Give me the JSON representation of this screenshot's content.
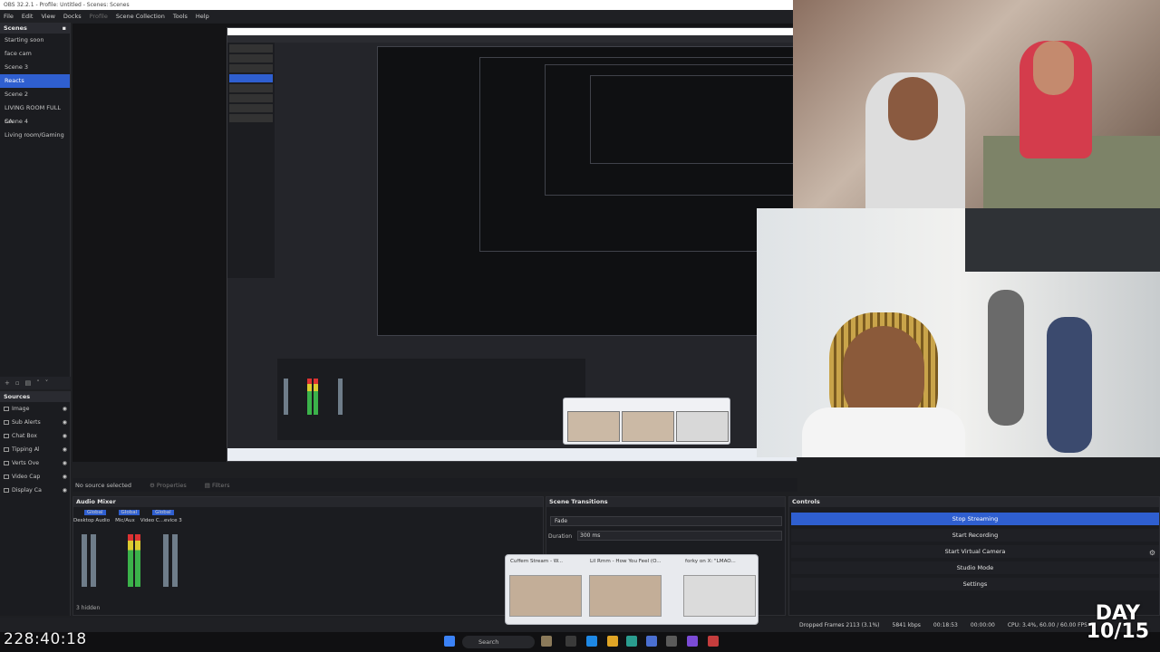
{
  "app": {
    "title": "OBS 32.2.1 - Profile: Untitled - Scenes: Scenes",
    "menu": [
      "File",
      "Edit",
      "View",
      "Docks",
      "Profile",
      "Scene Collection",
      "Tools",
      "Help"
    ]
  },
  "scenes": {
    "header": "Scenes",
    "items": [
      "Starting soon",
      "face cam",
      "Scene 3",
      "Reacts",
      "Scene 2",
      "LIVING ROOM FULL CA",
      "Scene 4",
      "Living room/Gaming"
    ],
    "active_index": 3
  },
  "sources": {
    "header": "Sources",
    "items": [
      "Image",
      "Sub Alerts",
      "Chat Box",
      "Tipping Al",
      "Verts Ove",
      "Video Cap",
      "Display Ca"
    ]
  },
  "source_toolbar": {
    "no_source": "No source selected",
    "properties": "Properties",
    "filters": "Filters"
  },
  "audio_mixer": {
    "header": "Audio Mixer",
    "tabs": [
      "Global",
      "Global",
      "Global"
    ],
    "channels": [
      "Desktop Audio",
      "Mic/Aux",
      "Video C...evice 3"
    ],
    "hidden_count": "3 hidden"
  },
  "scene_transitions": {
    "header": "Scene Transitions",
    "transition": "Fade",
    "duration_label": "Duration",
    "duration_value": "300 ms"
  },
  "controls": {
    "header": "Controls",
    "buttons": [
      "Stop Streaming",
      "Start Recording",
      "Start Virtual Camera",
      "Studio Mode",
      "Settings"
    ]
  },
  "status": {
    "dropped": "Dropped Frames 2113 (3.1%)",
    "bitrate": "5841 kbps",
    "stream_time": "00:18:53",
    "rec_time": "00:00:00",
    "cpu": "CPU: 3.4%, 60.00 / 60.00 FPS"
  },
  "alt_tab": {
    "windows": [
      "Cuffem Stream - W...",
      "Lil Rmm - How You Feel (O...",
      "forky on X: \"LMAO..."
    ]
  },
  "taskbar": {
    "search_placeholder": "Search"
  },
  "overlay": {
    "clock": "228:40:18",
    "day_label": "DAY",
    "day_count": "10/15"
  }
}
